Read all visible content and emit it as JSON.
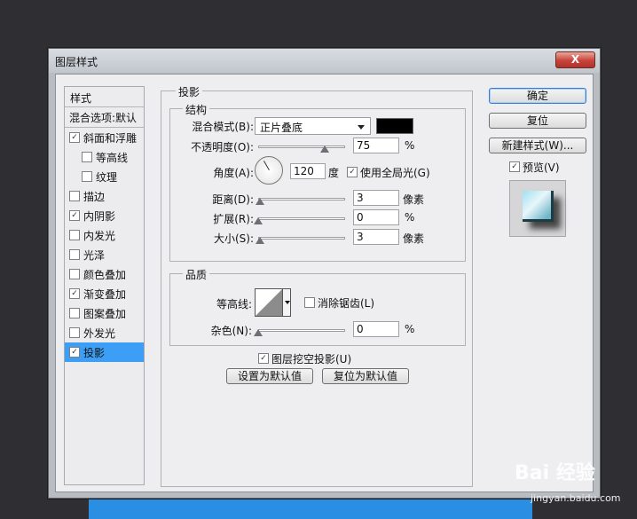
{
  "window": {
    "title": "图层样式",
    "close_label": "X"
  },
  "styles_list": {
    "header": "样式",
    "blend_options": "混合选项:默认",
    "items": [
      {
        "label": "斜面和浮雕",
        "checked": true,
        "sub": false,
        "selected": false
      },
      {
        "label": "等高线",
        "checked": false,
        "sub": true,
        "selected": false
      },
      {
        "label": "纹理",
        "checked": false,
        "sub": true,
        "selected": false
      },
      {
        "label": "描边",
        "checked": false,
        "sub": false,
        "selected": false
      },
      {
        "label": "内阴影",
        "checked": true,
        "sub": false,
        "selected": false
      },
      {
        "label": "内发光",
        "checked": false,
        "sub": false,
        "selected": false
      },
      {
        "label": "光泽",
        "checked": false,
        "sub": false,
        "selected": false
      },
      {
        "label": "颜色叠加",
        "checked": false,
        "sub": false,
        "selected": false
      },
      {
        "label": "渐变叠加",
        "checked": true,
        "sub": false,
        "selected": false
      },
      {
        "label": "图案叠加",
        "checked": false,
        "sub": false,
        "selected": false
      },
      {
        "label": "外发光",
        "checked": false,
        "sub": false,
        "selected": false
      },
      {
        "label": "投影",
        "checked": true,
        "sub": false,
        "selected": true
      }
    ]
  },
  "drop_shadow": {
    "section_title": "投影",
    "structure": {
      "title": "结构",
      "blend_mode_label": "混合模式(B):",
      "blend_mode_value": "正片叠底",
      "blend_color": "#000000",
      "opacity_label": "不透明度(O):",
      "opacity_value": "75",
      "opacity_unit": "%",
      "angle_label": "角度(A):",
      "angle_value": "120",
      "angle_unit": "度",
      "global_light_label": "使用全局光(G)",
      "global_light_checked": true,
      "distance_label": "距离(D):",
      "distance_value": "3",
      "distance_unit": "像素",
      "spread_label": "扩展(R):",
      "spread_value": "0",
      "spread_unit": "%",
      "size_label": "大小(S):",
      "size_value": "3",
      "size_unit": "像素"
    },
    "quality": {
      "title": "品质",
      "contour_label": "等高线:",
      "antialias_label": "消除锯齿(L)",
      "antialias_checked": false,
      "noise_label": "杂色(N):",
      "noise_value": "0",
      "noise_unit": "%"
    },
    "knockout_label": "图层挖空投影(U)",
    "knockout_checked": true,
    "make_default_label": "设置为默认值",
    "reset_default_label": "复位为默认值"
  },
  "right_panel": {
    "ok_label": "确定",
    "reset_label": "复位",
    "new_style_label": "新建样式(W)...",
    "preview_label": "预览(V)",
    "preview_checked": true
  },
  "watermark": {
    "brand": "Bai 经验",
    "url": "jingyan.baidu.com"
  }
}
